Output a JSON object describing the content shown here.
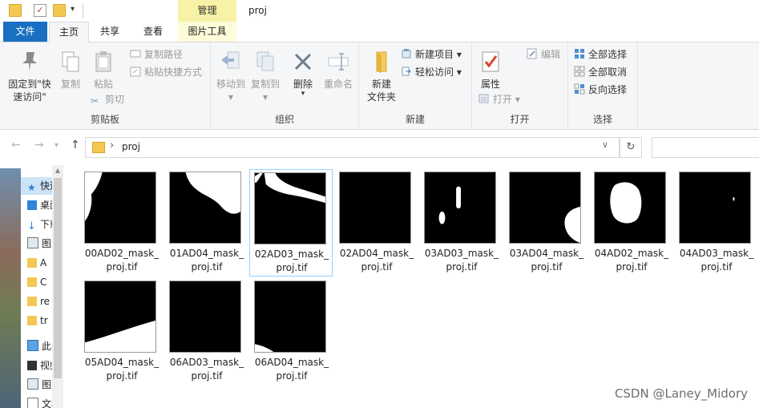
{
  "window": {
    "title": "proj",
    "context_tab": "管理"
  },
  "tabs": [
    {
      "label": "文件"
    },
    {
      "label": "主页"
    },
    {
      "label": "共享"
    },
    {
      "label": "查看"
    },
    {
      "label": "图片工具"
    }
  ],
  "ribbon": {
    "clipboard": {
      "pin": "固定到\"快速访问\"",
      "copy": "复制",
      "paste": "粘贴",
      "copy_path": "复制路径",
      "paste_shortcut": "粘贴快捷方式",
      "cut": "剪切",
      "label": "剪贴板"
    },
    "organize": {
      "move_to": "移动到",
      "copy_to": "复制到",
      "delete": "删除",
      "rename": "重命名",
      "label": "组织"
    },
    "new": {
      "new_folder": "新建\n文件夹",
      "new_item": "新建项目",
      "easy_access": "轻松访问",
      "label": "新建"
    },
    "open": {
      "properties": "属性",
      "open": "打开",
      "edit": "编辑",
      "label": "打开"
    },
    "select": {
      "select_all": "全部选择",
      "select_none": "全部取消",
      "invert": "反向选择",
      "label": "选择"
    }
  },
  "address": {
    "path": "proj"
  },
  "nav_pane": {
    "items": [
      {
        "label": "快速访问"
      },
      {
        "label": "桌面"
      },
      {
        "label": "下载"
      },
      {
        "label": "图片"
      },
      {
        "label": "A"
      },
      {
        "label": "C"
      },
      {
        "label": "re"
      },
      {
        "label": "tr"
      },
      {
        "label": "此电脑"
      },
      {
        "label": "视频"
      },
      {
        "label": "图片"
      },
      {
        "label": "文档"
      }
    ]
  },
  "files": [
    {
      "name1": "00AD02_mask_",
      "name2": "proj.tif"
    },
    {
      "name1": "01AD04_mask_",
      "name2": "proj.tif"
    },
    {
      "name1": "02AD03_mask_",
      "name2": "proj.tif"
    },
    {
      "name1": "02AD04_mask_",
      "name2": "proj.tif"
    },
    {
      "name1": "03AD03_mask_",
      "name2": "proj.tif"
    },
    {
      "name1": "03AD04_mask_",
      "name2": "proj.tif"
    },
    {
      "name1": "04AD02_mask_",
      "name2": "proj.tif"
    },
    {
      "name1": "04AD03_mask_",
      "name2": "proj.tif"
    },
    {
      "name1": "05AD04_mask_",
      "name2": "proj.tif"
    },
    {
      "name1": "06AD03_mask_",
      "name2": "proj.tif"
    },
    {
      "name1": "06AD04_mask_",
      "name2": "proj.tif"
    }
  ],
  "watermark": "CSDN @Laney_Midory",
  "colors": {
    "accent": "#1a6fc3",
    "context_tab": "#f7f2a5",
    "selection": "#cce4f7"
  }
}
